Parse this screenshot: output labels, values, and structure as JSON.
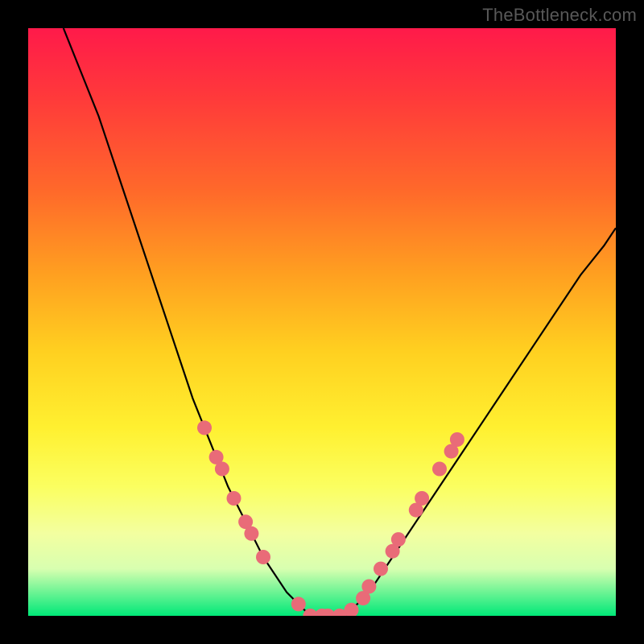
{
  "watermark": "TheBottleneck.com",
  "chart_data": {
    "type": "line",
    "title": "",
    "xlabel": "",
    "ylabel": "",
    "ylim": [
      0,
      100
    ],
    "xlim": [
      0,
      100
    ],
    "series": [
      {
        "name": "bottleneck-curve",
        "x": [
          6,
          8,
          10,
          12,
          14,
          16,
          18,
          20,
          22,
          24,
          26,
          28,
          30,
          32,
          34,
          36,
          38,
          40,
          42,
          44,
          46,
          48,
          50,
          52,
          54,
          56,
          58,
          60,
          62,
          66,
          70,
          74,
          78,
          82,
          86,
          90,
          94,
          98,
          100
        ],
        "y": [
          100,
          95,
          90,
          85,
          79,
          73,
          67,
          61,
          55,
          49,
          43,
          37,
          32,
          27,
          22,
          18,
          14,
          10,
          7,
          4,
          2,
          0,
          0,
          0,
          0,
          2,
          4,
          7,
          10,
          16,
          22,
          28,
          34,
          40,
          46,
          52,
          58,
          63,
          66
        ]
      }
    ],
    "markers": [
      {
        "x": 30,
        "y": 32
      },
      {
        "x": 32,
        "y": 27
      },
      {
        "x": 33,
        "y": 25
      },
      {
        "x": 35,
        "y": 20
      },
      {
        "x": 37,
        "y": 16
      },
      {
        "x": 38,
        "y": 14
      },
      {
        "x": 40,
        "y": 10
      },
      {
        "x": 46,
        "y": 2
      },
      {
        "x": 48,
        "y": 0
      },
      {
        "x": 50,
        "y": 0
      },
      {
        "x": 51,
        "y": 0
      },
      {
        "x": 53,
        "y": 0
      },
      {
        "x": 55,
        "y": 1
      },
      {
        "x": 57,
        "y": 3
      },
      {
        "x": 58,
        "y": 5
      },
      {
        "x": 60,
        "y": 8
      },
      {
        "x": 62,
        "y": 11
      },
      {
        "x": 63,
        "y": 13
      },
      {
        "x": 66,
        "y": 18
      },
      {
        "x": 67,
        "y": 20
      },
      {
        "x": 70,
        "y": 25
      },
      {
        "x": 72,
        "y": 28
      },
      {
        "x": 73,
        "y": 30
      }
    ],
    "colors": {
      "curve": "#000000",
      "marker": "#e96b78"
    }
  }
}
